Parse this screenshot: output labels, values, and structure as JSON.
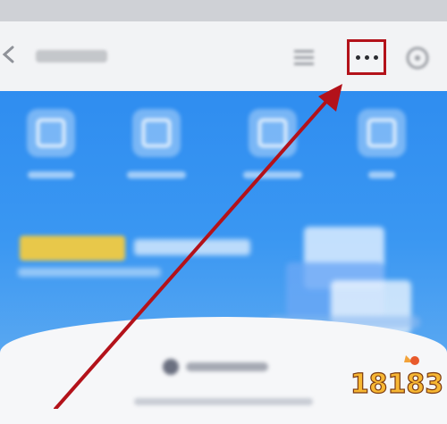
{
  "nav": {
    "title": "",
    "more_label": "•••"
  },
  "watermark": {
    "text": "18183"
  },
  "colors": {
    "accent_blue": "#3a97f2",
    "highlight_red": "#b3121a",
    "badge_gold": "#e8c84a"
  },
  "icons": [
    "back-icon",
    "menu-icon",
    "more-icon",
    "close-icon"
  ]
}
